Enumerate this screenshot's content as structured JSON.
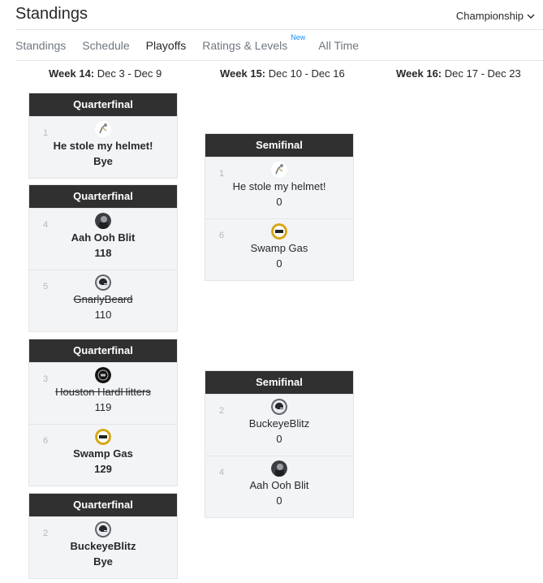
{
  "header": {
    "title": "Standings",
    "league_select": "Championship"
  },
  "tabs": [
    {
      "label": "Standings",
      "active": false
    },
    {
      "label": "Schedule",
      "active": false
    },
    {
      "label": "Playoffs",
      "active": true
    },
    {
      "label": "Ratings & Levels",
      "badge": "New",
      "active": false
    },
    {
      "label": "All Time",
      "active": false
    }
  ],
  "weeks": [
    {
      "name": "Week 14:",
      "dates": "Dec 3 - Dec 9"
    },
    {
      "name": "Week 15:",
      "dates": "Dec 10 - Dec 16"
    },
    {
      "name": "Week 16:",
      "dates": "Dec 17 - Dec 23"
    }
  ],
  "quarterfinals": [
    {
      "title": "Quarterfinal",
      "teams": [
        {
          "seed": "1",
          "name": "He stole my helmet!",
          "score": "Bye",
          "winner": true,
          "eliminated": false,
          "avatar": "helmet-figure-avatar"
        }
      ]
    },
    {
      "title": "Quarterfinal",
      "teams": [
        {
          "seed": "4",
          "name": "Aah Ooh Blit",
          "score": "118",
          "winner": true,
          "eliminated": false,
          "avatar": "dark-photo-avatar"
        },
        {
          "seed": "5",
          "name": "GnarlyBeard",
          "score": "110",
          "winner": false,
          "eliminated": true,
          "avatar": "helmet-avatar"
        }
      ]
    },
    {
      "title": "Quarterfinal",
      "teams": [
        {
          "seed": "3",
          "name": "Houston HardHitters",
          "score": "119",
          "winner": false,
          "eliminated": true,
          "avatar": "black-logo-avatar"
        },
        {
          "seed": "6",
          "name": "Swamp Gas",
          "score": "129",
          "winner": true,
          "eliminated": false,
          "avatar": "gold-logo-avatar"
        }
      ]
    },
    {
      "title": "Quarterfinal",
      "teams": [
        {
          "seed": "2",
          "name": "BuckeyeBlitz",
          "score": "Bye",
          "winner": true,
          "eliminated": false,
          "avatar": "helmet-avatar"
        }
      ]
    }
  ],
  "semifinals": [
    {
      "title": "Semifinal",
      "teams": [
        {
          "seed": "1",
          "name": "He stole my helmet!",
          "score": "0",
          "winner": false,
          "eliminated": false,
          "avatar": "helmet-figure-avatar"
        },
        {
          "seed": "6",
          "name": "Swamp Gas",
          "score": "0",
          "winner": false,
          "eliminated": false,
          "avatar": "gold-logo-avatar"
        }
      ]
    },
    {
      "title": "Semifinal",
      "teams": [
        {
          "seed": "2",
          "name": "BuckeyeBlitz",
          "score": "0",
          "winner": false,
          "eliminated": false,
          "avatar": "helmet-avatar"
        },
        {
          "seed": "4",
          "name": "Aah Ooh Blit",
          "score": "0",
          "winner": false,
          "eliminated": false,
          "avatar": "dark-photo-avatar"
        }
      ]
    }
  ],
  "colors": {
    "header_bg": "#303030",
    "card_bg": "#f3f4f5",
    "link_blue": "#188fff"
  }
}
